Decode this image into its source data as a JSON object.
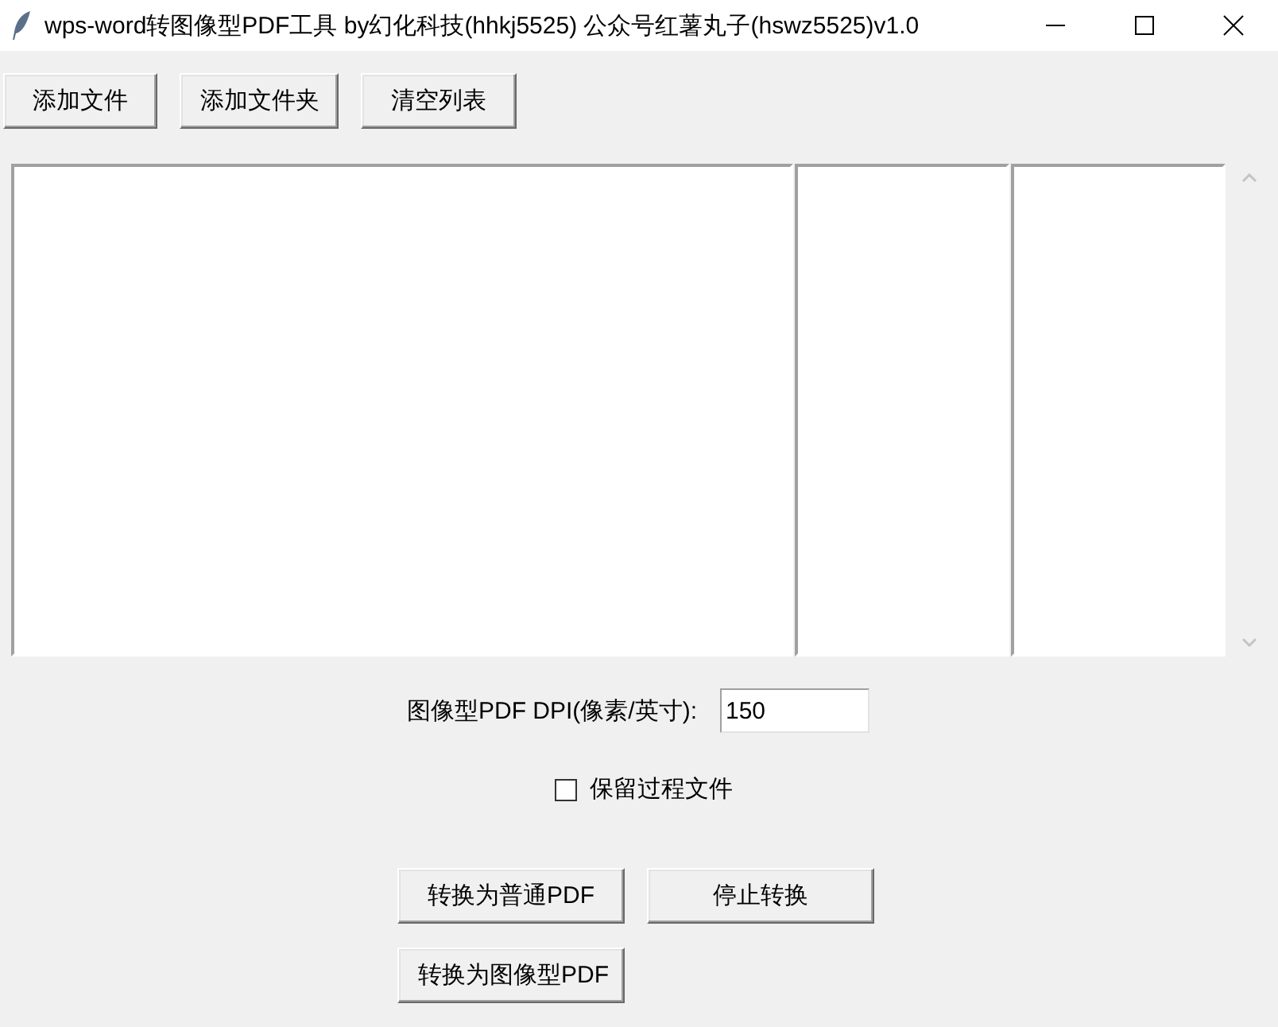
{
  "window": {
    "title": "wps-word转图像型PDF工具 by幻化科技(hhkj5525) 公众号红薯丸子(hswz5525)v1.0"
  },
  "toolbar": {
    "buttons": [
      "添加文件",
      "添加文件夹",
      "清空列表"
    ]
  },
  "file_lists": {
    "panes": [
      {
        "kind": "list"
      },
      {
        "kind": "list"
      },
      {
        "kind": "list"
      }
    ]
  },
  "dpi": {
    "label": "图像型PDF DPI(像素/英寸):",
    "value": "150"
  },
  "keep_files": {
    "label": "保留过程文件",
    "checked": false
  },
  "actions": [
    {
      "buttons": [
        "转换为普通PDF",
        "停止转换"
      ]
    },
    {
      "buttons": [
        "转换为图像型PDF"
      ]
    }
  ]
}
